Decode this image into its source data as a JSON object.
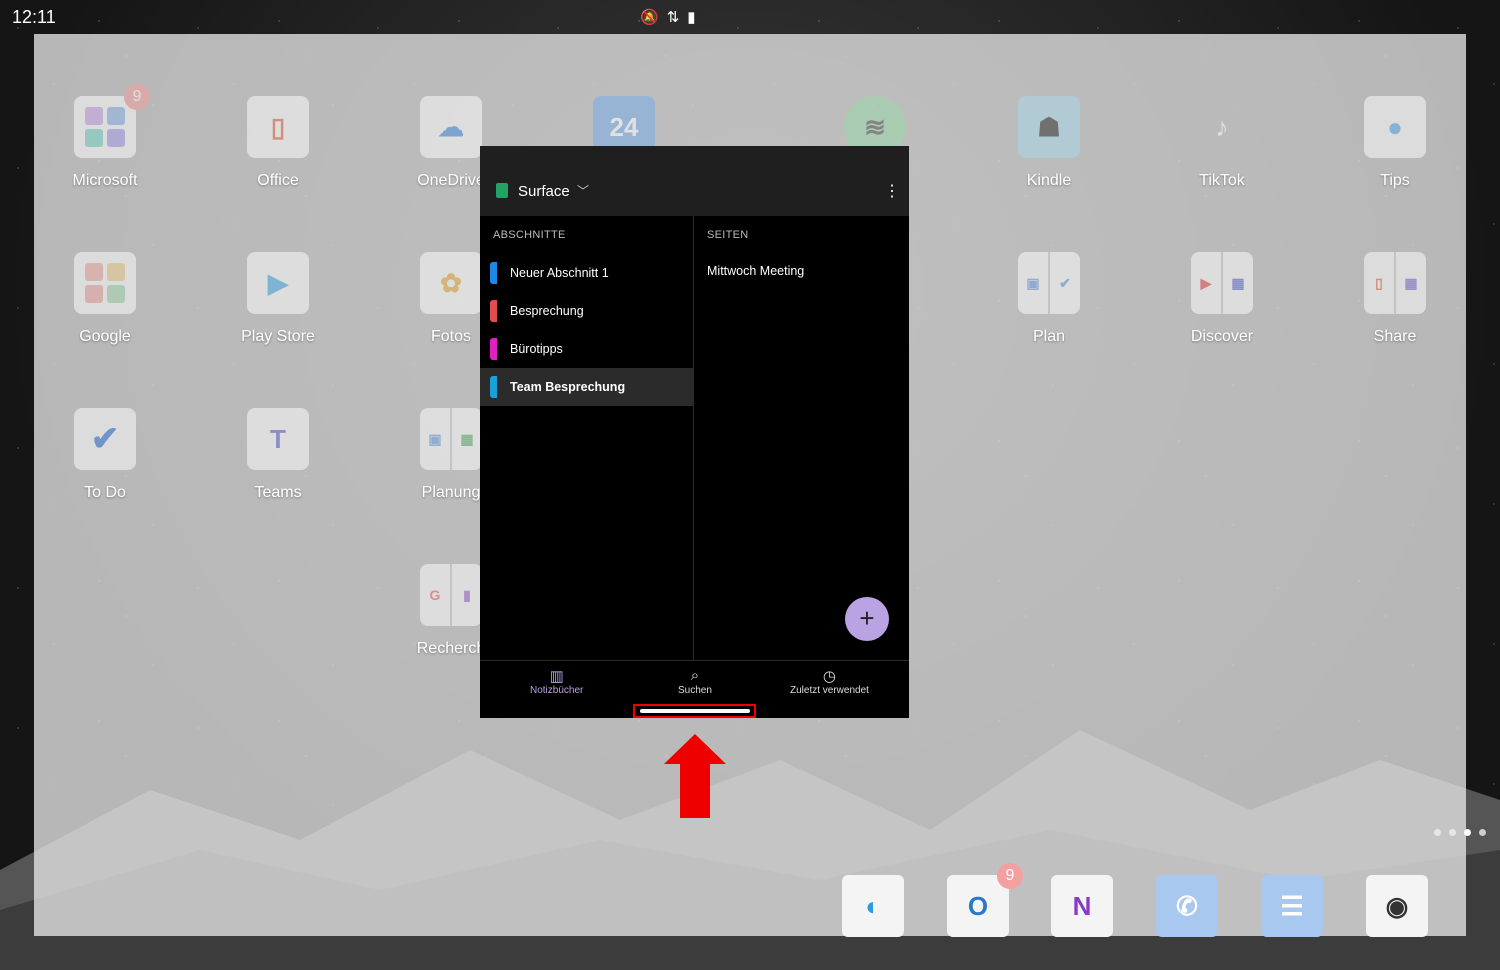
{
  "status_bar": {
    "time": "12:11",
    "icons": [
      "mute-icon",
      "wifi-icon",
      "battery-icon"
    ]
  },
  "home_apps": [
    {
      "name": "Microsoft",
      "badge": "9"
    },
    {
      "name": "Office"
    },
    {
      "name": "OneDrive"
    },
    {
      "name": "Kindle"
    },
    {
      "name": "TikTok"
    },
    {
      "name": "Tips"
    },
    {
      "name": "Google"
    },
    {
      "name": "Play Store"
    },
    {
      "name": "Fotos"
    },
    {
      "name": "Plan"
    },
    {
      "name": "Discover"
    },
    {
      "name": "Share"
    },
    {
      "name": "To Do"
    },
    {
      "name": "Teams"
    },
    {
      "name": "Planung"
    },
    {
      "name": "Recherch"
    }
  ],
  "calendar_icon_text": "24",
  "dock": [
    {
      "name": "edge-icon"
    },
    {
      "name": "outlook-icon",
      "glyph": "O",
      "badge": "9"
    },
    {
      "name": "onenote-icon",
      "glyph": "N"
    },
    {
      "name": "phone-icon"
    },
    {
      "name": "messages-icon"
    },
    {
      "name": "camera-icon"
    }
  ],
  "onenote": {
    "notebook_title": "Surface",
    "sections_heading": "ABSCHNITTE",
    "pages_heading": "SEITEN",
    "sections": [
      {
        "label": "Neuer Abschnitt 1",
        "color": "#1e88e5"
      },
      {
        "label": "Besprechung",
        "color": "#e04e4e"
      },
      {
        "label": "Bürotipps",
        "color": "#e020c0"
      },
      {
        "label": "Team Besprechung",
        "color": "#1aa0d8",
        "selected": true
      }
    ],
    "pages": [
      "Mittwoch Meeting"
    ],
    "fab_symbol": "+",
    "nav": {
      "notebooks": "Notizbücher",
      "search": "Suchen",
      "recent": "Zuletzt verwendet"
    }
  },
  "colors": {
    "accent_purple": "#b9a3e3",
    "highlight_red": "#e00000"
  }
}
